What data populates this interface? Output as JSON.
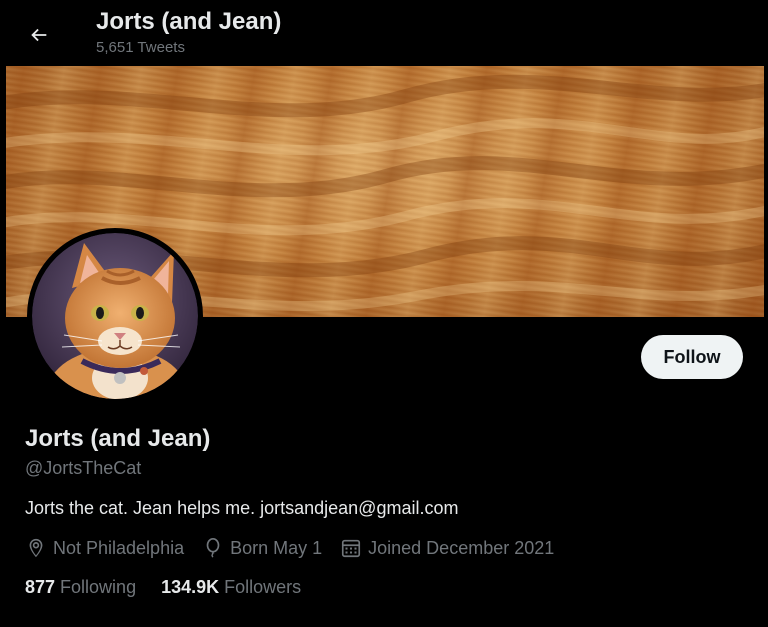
{
  "header": {
    "title": "Jorts (and Jean)",
    "tweet_count": "5,651 Tweets",
    "back_icon": "arrow-left-icon"
  },
  "banner": {
    "description_icon": "orange-fur-banner"
  },
  "profile": {
    "avatar_icon": "orange-cat-avatar",
    "follow_label": "Follow",
    "display_name": "Jorts (and Jean)",
    "handle": "@JortsTheCat",
    "bio": "Jorts the cat. Jean helps me. jortsandjean@gmail.com",
    "location": "Not Philadelphia",
    "birthday": "Born May 1",
    "joined": "Joined December 2021",
    "following_count": "877",
    "following_label": "Following",
    "followers_count": "134.9K",
    "followers_label": "Followers"
  },
  "colors": {
    "background": "#000000",
    "primary_text": "#e7e9ea",
    "secondary_text": "#71767b",
    "follow_button_bg": "#eff3f4",
    "follow_button_text": "#0f1419"
  }
}
